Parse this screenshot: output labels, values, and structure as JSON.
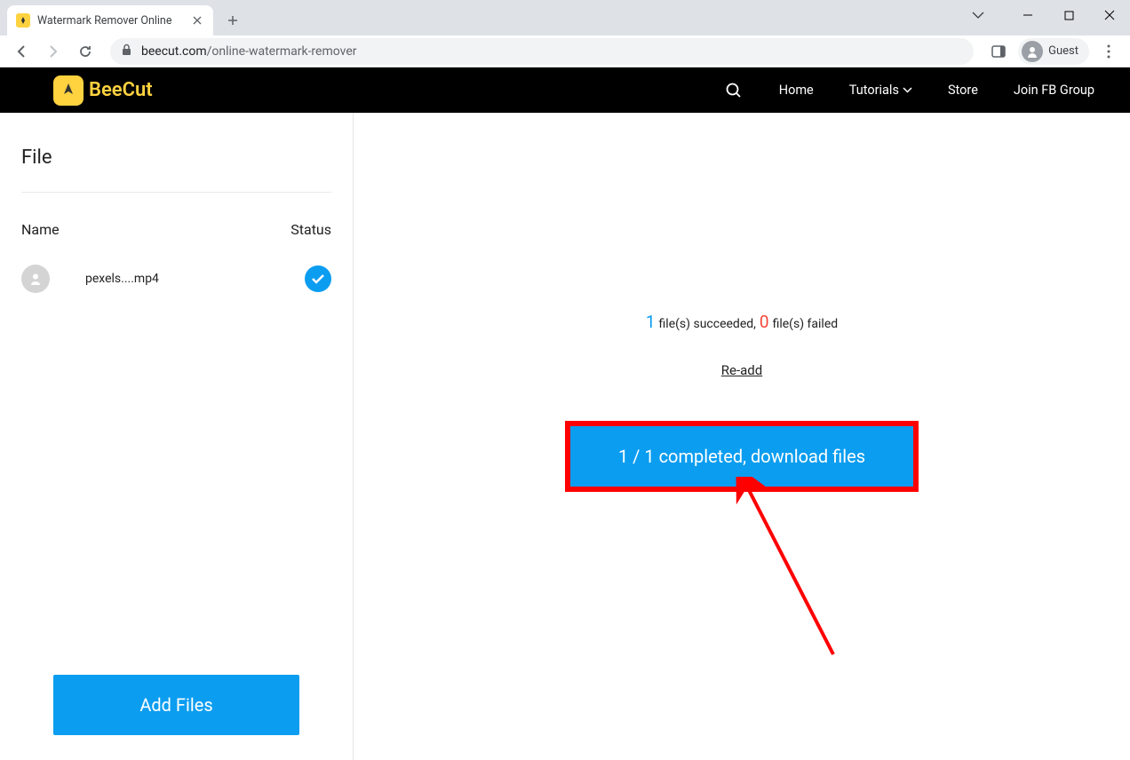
{
  "browser": {
    "tab_title": "Watermark Remover Online",
    "url_domain": "beecut.com",
    "url_path": "/online-watermark-remover",
    "guest_label": "Guest"
  },
  "header": {
    "brand": "BeeCut",
    "nav": {
      "home": "Home",
      "tutorials": "Tutorials",
      "store": "Store",
      "fb_group": "Join FB Group"
    }
  },
  "sidebar": {
    "title": "File",
    "col_name": "Name",
    "col_status": "Status",
    "file_name": "pexels....mp4",
    "add_files": "Add Files"
  },
  "main": {
    "success_count": "1",
    "success_text": "file(s) succeeded,",
    "fail_count": "0",
    "fail_text": "file(s) failed",
    "readd": "Re-add",
    "download_label": "1 / 1 completed, download files"
  }
}
